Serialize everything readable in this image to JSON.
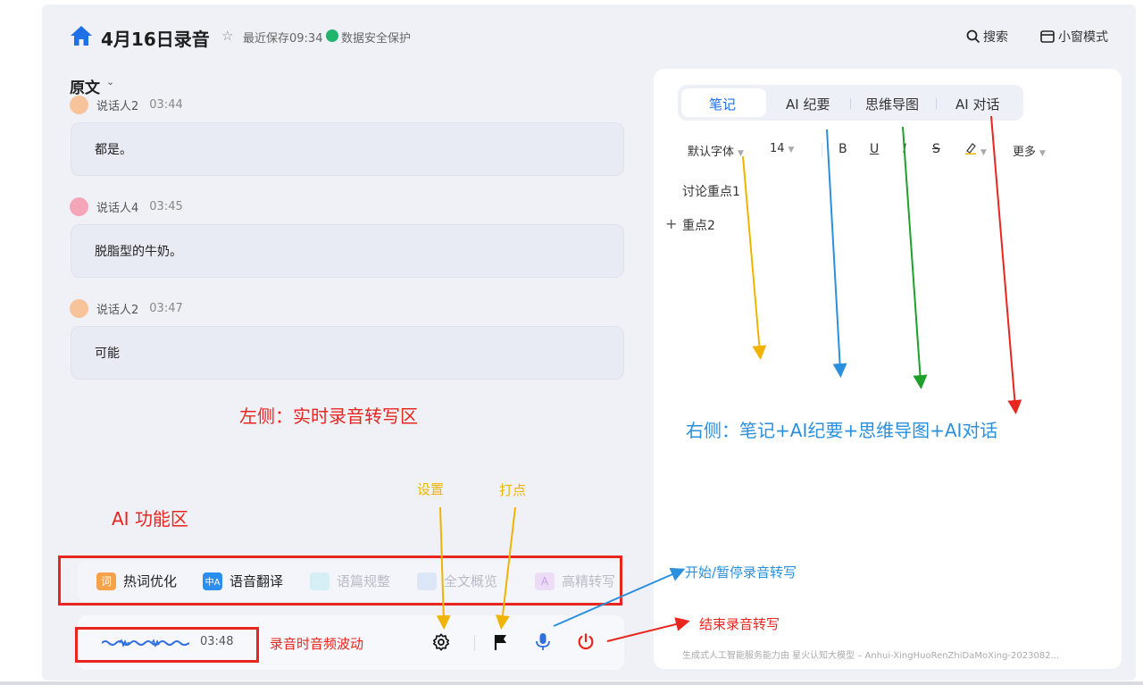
{
  "header": {
    "title": "4月16日录音",
    "save_time": "最近保存09:34",
    "secure_text": "数据安全保护",
    "search_label": "搜索",
    "mini_label": "小窗模式"
  },
  "transcript": {
    "label": "原文",
    "entries": [
      {
        "speaker": "说话人2",
        "time": "03:44",
        "text": "都是。",
        "avatar_color": "#f7c39a"
      },
      {
        "speaker": "说话人4",
        "time": "03:45",
        "text": "脱脂型的牛奶。",
        "avatar_color": "#f4a6b8"
      },
      {
        "speaker": "说话人2",
        "time": "03:47",
        "text": "可能",
        "avatar_color": "#f7c39a"
      }
    ]
  },
  "ai_functions": [
    {
      "label": "热词优化",
      "icon": "词",
      "icon_color": "#f5a24b",
      "enabled": true
    },
    {
      "label": "语音翻译",
      "icon": "中A",
      "icon_color": "#2b8ff0",
      "enabled": true
    },
    {
      "label": "语篇规整",
      "icon": "list-icon",
      "icon_color": "#bfe3ef",
      "enabled": false
    },
    {
      "label": "全文概览",
      "icon": "doc-icon",
      "icon_color": "#c9dcf3",
      "enabled": false
    },
    {
      "label": "高精转写",
      "icon": "A",
      "icon_color": "#e7d4f4",
      "enabled": false
    }
  ],
  "recording": {
    "time": "03:48"
  },
  "right_panel": {
    "tabs": [
      "笔记",
      "AI 纪要",
      "思维导图",
      "AI 对话"
    ],
    "active_tab": 0,
    "toolbar": {
      "font": "默认字体",
      "size": "14",
      "bold": "B",
      "underline": "U",
      "italic": "I",
      "strike": "S",
      "more": "更多"
    },
    "notes": [
      "讨论重点1",
      "重点2"
    ],
    "footer": "生成式人工智能服务能力由 星火认知大模型 – Anhui-XingHuoRenZhiDaMoXing-2023082..."
  },
  "annotations": {
    "left_area": "左侧：实时录音转写区",
    "right_area": "右侧：笔记+AI纪要+思维导图+AI对话",
    "ai_area": "AI 功能区",
    "settings": "设置",
    "mark": "打点",
    "start_pause": "开始/暂停录音转写",
    "end": "结束录音转写",
    "wave": "录音时音频波动"
  },
  "colors": {
    "accent": "#1f6fe5",
    "annotation_red": "#e8261f",
    "annotation_blue": "#2a8fdc",
    "annotation_yellow": "#f0b400"
  }
}
